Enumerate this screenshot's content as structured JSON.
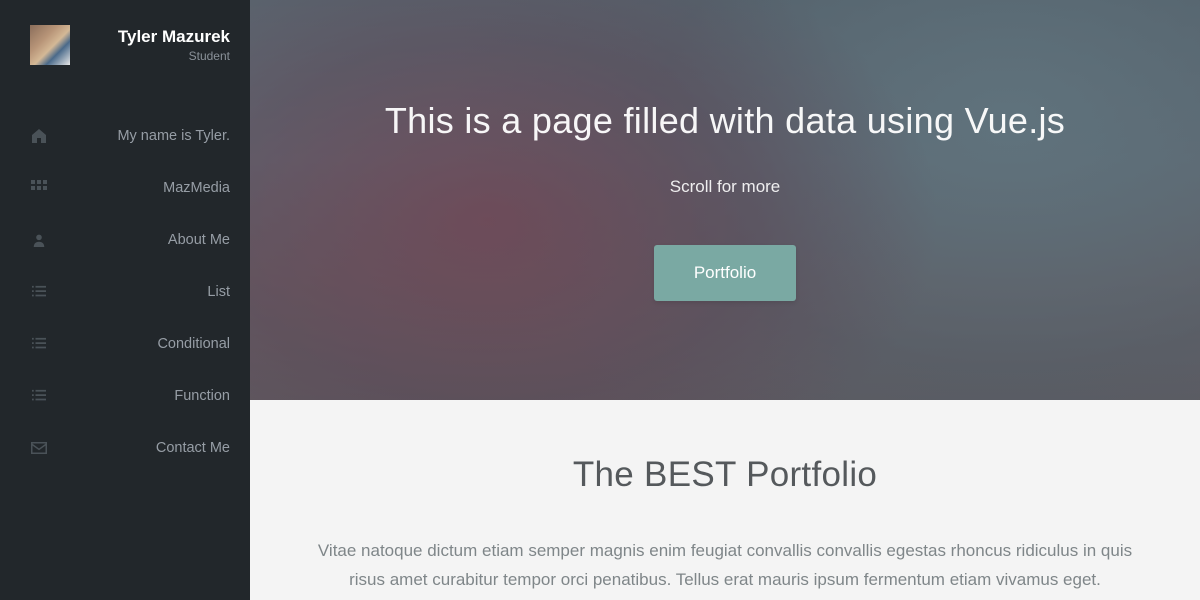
{
  "profile": {
    "name": "Tyler Mazurek",
    "role": "Student"
  },
  "nav": {
    "items": [
      {
        "icon": "home",
        "label": "My name is Tyler."
      },
      {
        "icon": "grid",
        "label": "MazMedia"
      },
      {
        "icon": "user",
        "label": "About Me"
      },
      {
        "icon": "list",
        "label": "List"
      },
      {
        "icon": "list",
        "label": "Conditional"
      },
      {
        "icon": "list",
        "label": "Function"
      },
      {
        "icon": "envelope",
        "label": "Contact Me"
      }
    ]
  },
  "hero": {
    "title": "This is a page filled with data using Vue.js",
    "subtitle": "Scroll for more",
    "button": "Portfolio"
  },
  "content": {
    "title": "The BEST Portfolio",
    "body": "Vitae natoque dictum etiam semper magnis enim feugiat convallis convallis egestas rhoncus ridiculus in quis risus amet curabitur tempor orci penatibus. Tellus erat mauris ipsum fermentum etiam vivamus eget."
  }
}
